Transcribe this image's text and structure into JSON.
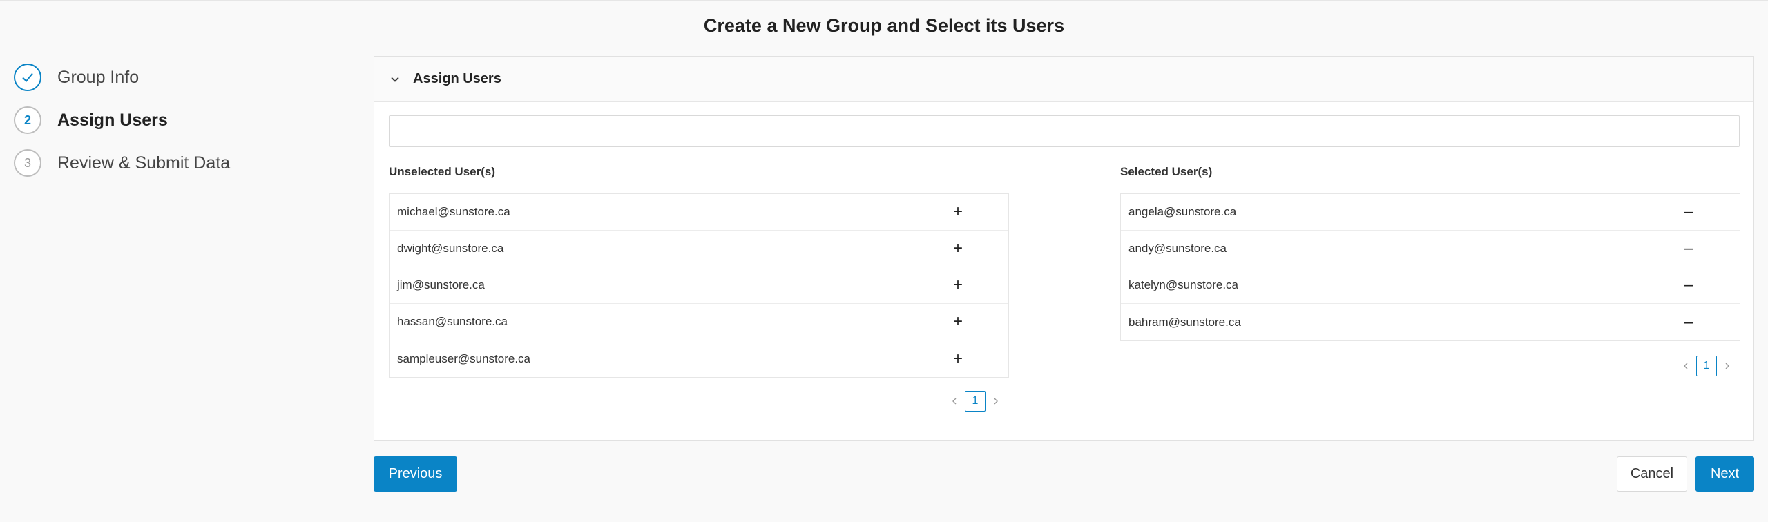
{
  "page": {
    "title": "Create a New Group and Select its Users"
  },
  "stepper": {
    "steps": [
      {
        "number": "",
        "label": "Group Info",
        "state": "done"
      },
      {
        "number": "2",
        "label": "Assign Users",
        "state": "active"
      },
      {
        "number": "3",
        "label": "Review & Submit Data",
        "state": "pending"
      }
    ]
  },
  "panel": {
    "title": "Assign Users",
    "search": {
      "value": "",
      "placeholder": ""
    },
    "unselected": {
      "title": "Unselected User(s)",
      "users": [
        "michael@sunstore.ca",
        "dwight@sunstore.ca",
        "jim@sunstore.ca",
        "hassan@sunstore.ca",
        "sampleuser@sunstore.ca"
      ],
      "add_symbol": "+",
      "page": "1"
    },
    "selected": {
      "title": "Selected User(s)",
      "users": [
        "angela@sunstore.ca",
        "andy@sunstore.ca",
        "katelyn@sunstore.ca",
        "bahram@sunstore.ca"
      ],
      "remove_symbol": "–",
      "page": "1"
    }
  },
  "footer": {
    "previous_label": "Previous",
    "cancel_label": "Cancel",
    "next_label": "Next"
  },
  "colors": {
    "accent": "#0a84c6",
    "background": "#f9f9f9"
  },
  "icons": {
    "step1": "checkmark-icon",
    "collapse": "chevron-down-icon",
    "prev": "chevron-left-icon",
    "next": "chevron-right-icon"
  }
}
